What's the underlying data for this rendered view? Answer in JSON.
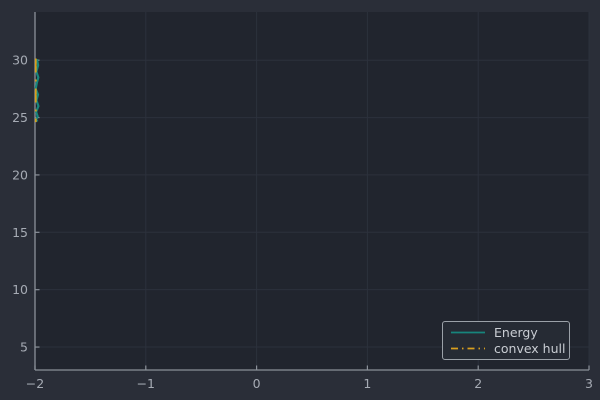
{
  "chart_data": {
    "type": "line",
    "title": "",
    "xlabel": "",
    "ylabel": "",
    "grid": true,
    "legend_position": "lower right",
    "xlim": [
      -2,
      3
    ],
    "ylim": [
      3.0,
      34.2
    ],
    "xticks": [
      -2,
      -1,
      0,
      1,
      2,
      3
    ],
    "yticks": [
      5,
      10,
      15,
      20,
      25,
      30
    ],
    "xtick_labels": [
      "−2",
      "−1",
      "0",
      "1",
      "2",
      "3"
    ],
    "ytick_labels": [
      "5",
      "10",
      "15",
      "20",
      "25",
      "30"
    ],
    "series": [
      {
        "name": "Energy",
        "color": "#17857c",
        "style": "solid",
        "linewidth": 2.2,
        "x": [
          -1.982,
          -1.972,
          -1.988,
          -1.97,
          -1.984,
          -1.994,
          -1.973,
          -1.987,
          -1.969,
          -1.99,
          -1.976,
          -1.991,
          -1.978
        ],
        "y": [
          30.1,
          29.55,
          29.0,
          28.5,
          28.0,
          27.5,
          27.0,
          26.5,
          26.0,
          25.5,
          25.1,
          24.8,
          24.65
        ]
      },
      {
        "name": "convex hull",
        "color": "#d9a01e",
        "style": "dashdot",
        "linewidth": 1.8,
        "x": [
          -1.993,
          -1.993
        ],
        "y": [
          30.15,
          24.6
        ]
      }
    ]
  },
  "colors": {
    "figure_bg": "#2a2e38",
    "axes_bg": "#21252e",
    "grid": "#2c313c",
    "spine": "#8b9199",
    "tick_label": "#a6abb4",
    "legend_border": "#9ba1a8",
    "legend_bg": "#262b34",
    "legend_text": "#c9cdd3"
  }
}
